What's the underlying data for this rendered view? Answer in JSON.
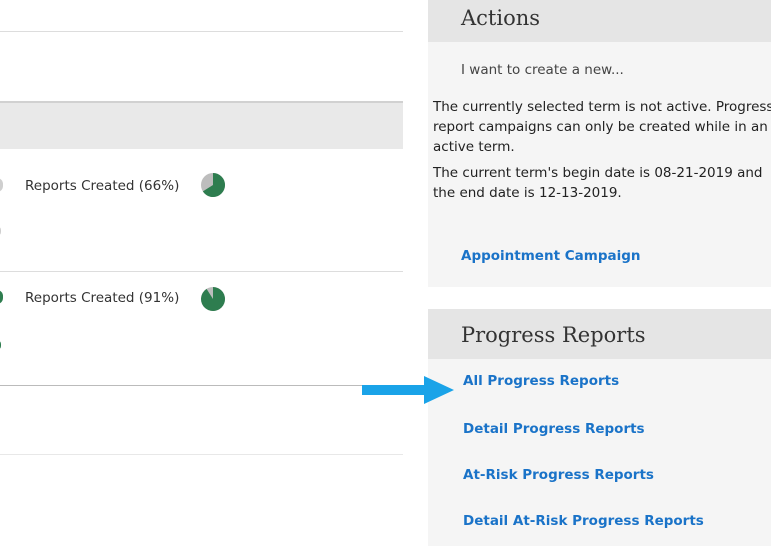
{
  "table": {
    "rows": [
      {
        "label": "Reports Created (66%)",
        "percent": 66
      },
      {
        "label": "Reports Created (91%)",
        "percent": 91
      }
    ]
  },
  "actions": {
    "title": "Actions",
    "subtext": "I want to create a new...",
    "message1": "The currently selected term is not active. Progress report campaigns can only be created while in an active term.",
    "message2": "The current term's begin date is 08-21-2019 and the end date is 12-13-2019.",
    "link_appointment": "Appointment Campaign"
  },
  "progress_reports": {
    "title": "Progress Reports",
    "links": [
      "All Progress Reports",
      "Detail Progress Reports",
      "At-Risk Progress Reports",
      "Detail At-Risk Progress Reports"
    ]
  },
  "colors": {
    "pie_filled": "#2e7d4f",
    "pie_empty": "#bdbdbd",
    "link": "#1a73c8",
    "arrow": "#1aa3e8"
  }
}
